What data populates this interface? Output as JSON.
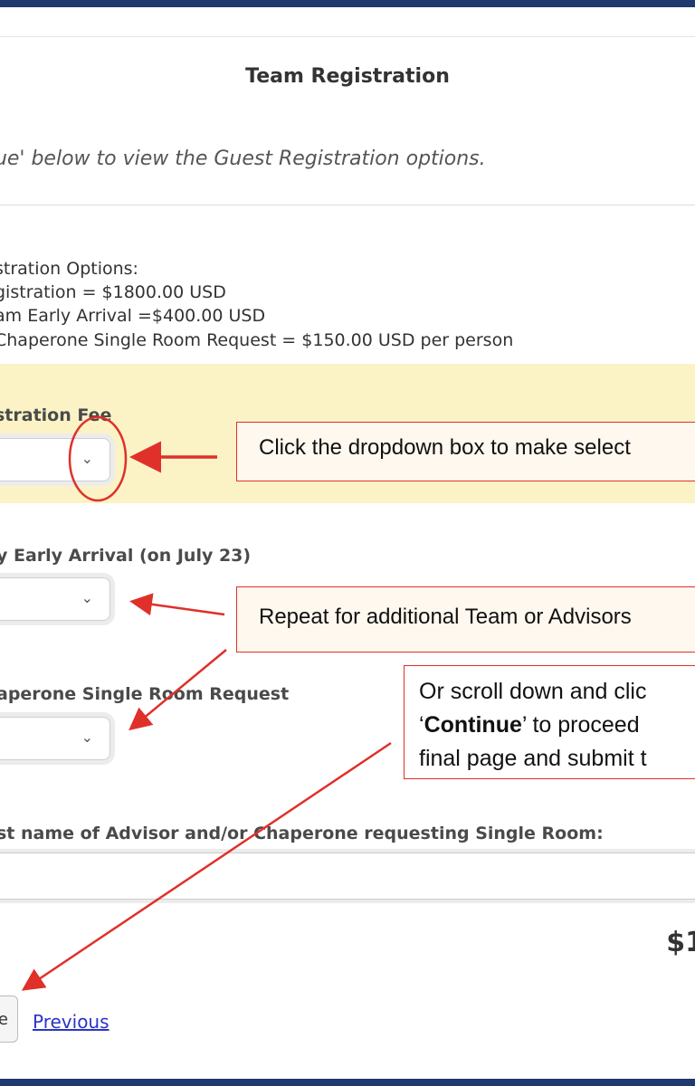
{
  "form": {
    "title": "Team Registration",
    "intro_text": "nue' below to view the Guest Registration options.",
    "options": {
      "heading": "stration Options:",
      "line1": "gistration = $1800.00 USD",
      "line2": "am Early Arrival =$400.00 USD",
      "line3": "Chaperone Single Room Request = $150.00 USD per person"
    },
    "fields": {
      "registration_fee_label": "stration Fee",
      "early_arrival_label": "y Early Arrival (on July 23)",
      "single_room_label": "aperone Single Room Request",
      "name_label": "st name of Advisor and/or Chaperone requesting Single Room:"
    },
    "total": "$1",
    "continue_label": "e",
    "previous_link": "Previous"
  },
  "annotations": {
    "note1": "Click the dropdown box to make select",
    "note2": "Repeat for additional Team or Advisors",
    "note3_line1": "Or scroll down and clic",
    "note3_q": "‘",
    "note3_bold": "Continue",
    "note3_rest": "’ to proceed",
    "note3_line3": "final page and submit t"
  },
  "colors": {
    "annotation_red": "#e0302a",
    "highlight_yellow": "#fbf3c6",
    "link_blue": "#2a34c7",
    "frame_navy": "#1e3a6e"
  }
}
